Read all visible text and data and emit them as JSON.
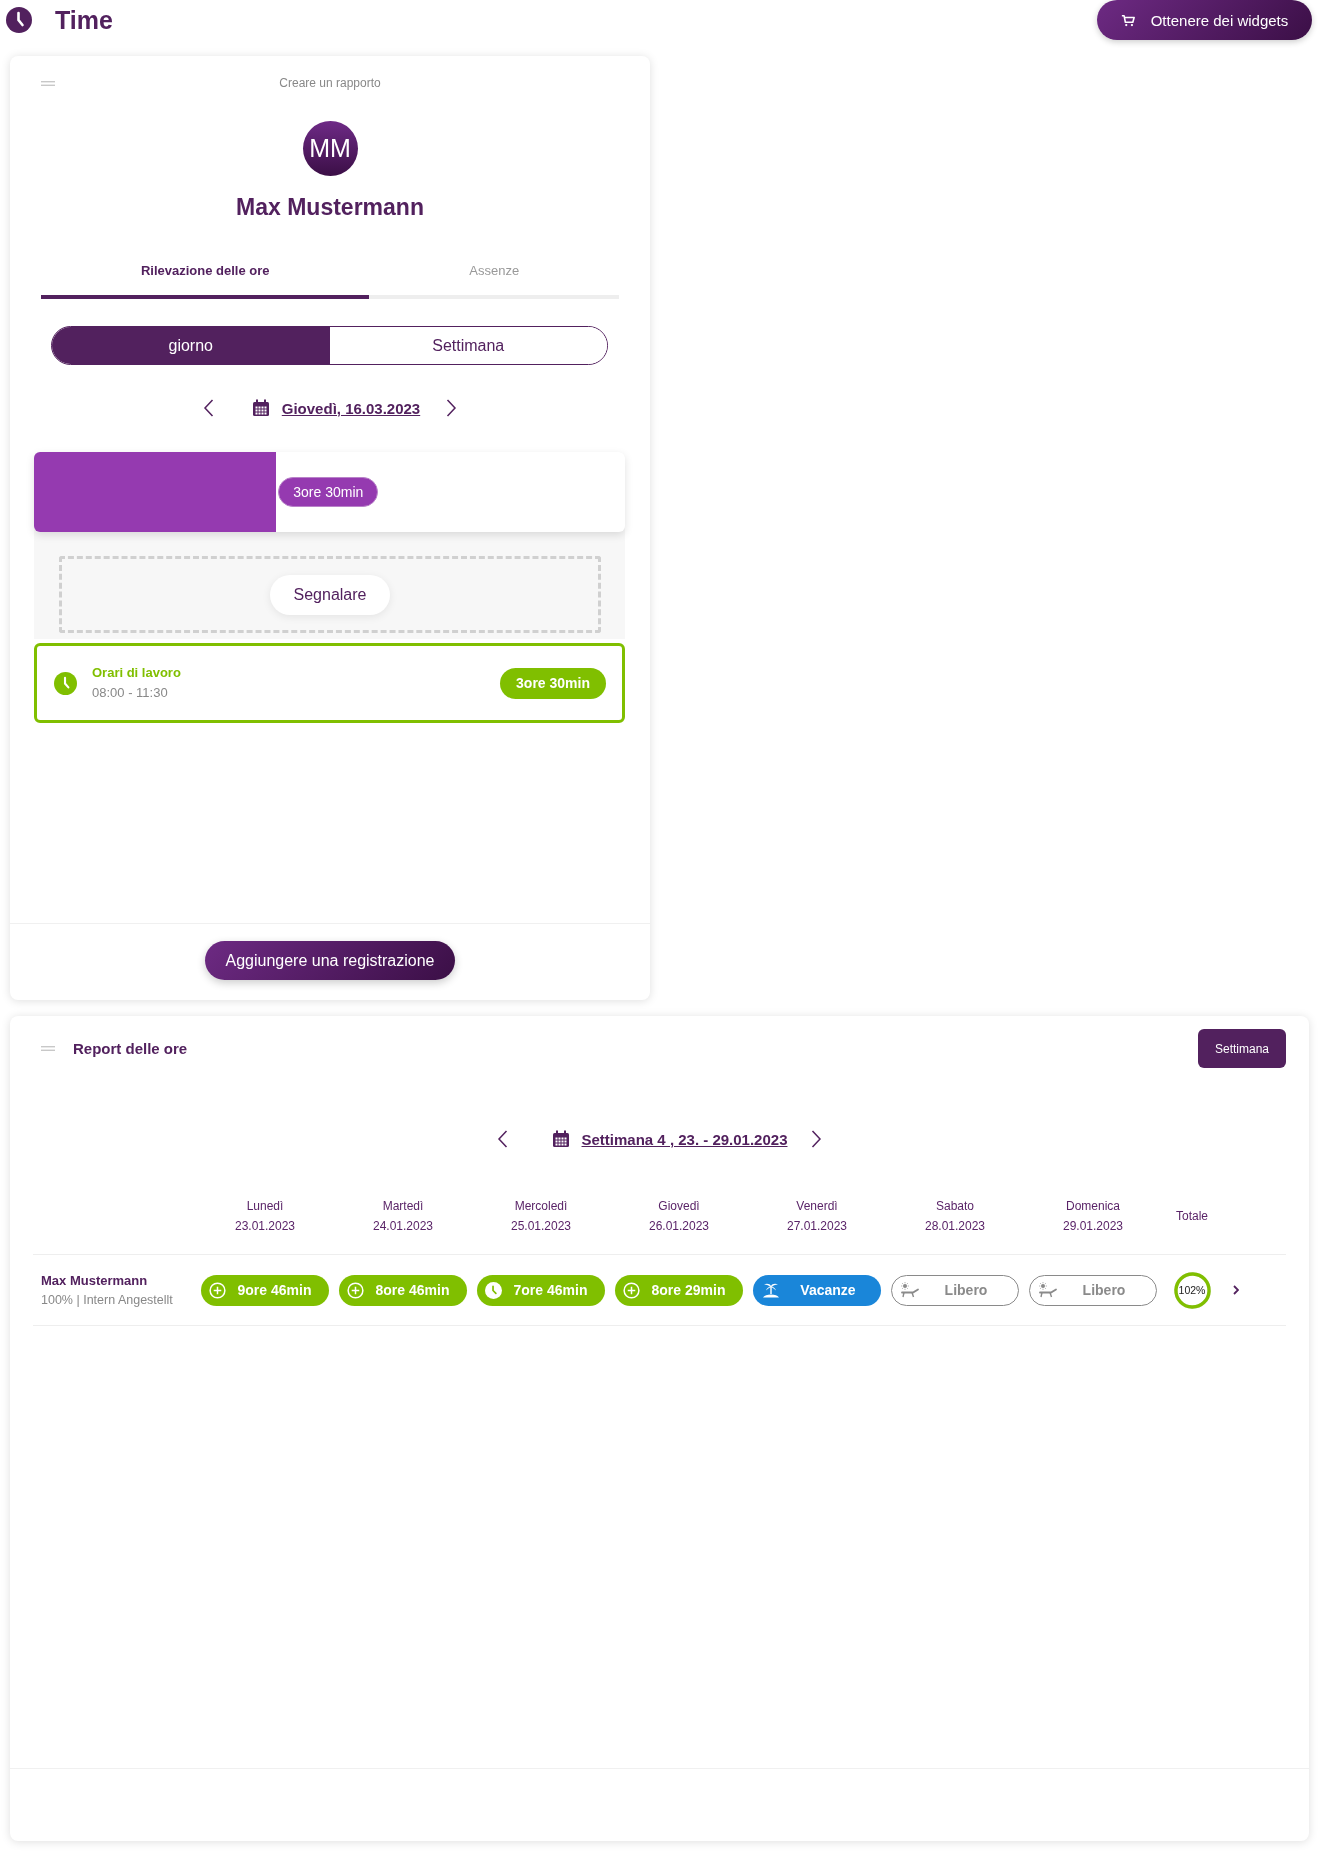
{
  "header": {
    "title": "Time",
    "widgets_button": "Ottenere dei widgets"
  },
  "day_card": {
    "title": "Creare un rapporto",
    "avatar": "MM",
    "name": "Max Mustermann",
    "tabs": [
      {
        "label": "Rilevazione delle ore",
        "selected": true
      },
      {
        "label": "Assenze",
        "selected": false
      }
    ],
    "view_toggle": [
      {
        "label": "giorno",
        "selected": true
      },
      {
        "label": "Settimana",
        "selected": false
      }
    ],
    "date": "Giovedì, 16.03.2023",
    "timeline": {
      "level": 0.41,
      "duration": "3ore 30min"
    },
    "report_button": "Segnalare",
    "entries": [
      {
        "kind": "work",
        "title": "Orari di lavoro",
        "time": "08:00 - 11:30",
        "duration": "3ore 30min"
      }
    ],
    "add_button": "Aggiungere una registrazione"
  },
  "report_card": {
    "title": "Report delle ore",
    "period_button": "Settimana",
    "week": "Settimana 4 , 23. - 29.01.2023",
    "columns": [
      {
        "day": "Lunedì",
        "date": "23.01.2023"
      },
      {
        "day": "Martedì",
        "date": "24.01.2023"
      },
      {
        "day": "Mercoledì",
        "date": "25.01.2023"
      },
      {
        "day": "Giovedì",
        "date": "26.01.2023"
      },
      {
        "day": "Venerdì",
        "date": "27.01.2023"
      },
      {
        "day": "Sabato",
        "date": "28.01.2023"
      },
      {
        "day": "Domenica",
        "date": "29.01.2023"
      }
    ],
    "total_column": "Totale",
    "rows": [
      {
        "name": "Max Mustermann",
        "details": "100% | Intern Angestellt",
        "days": [
          {
            "kind": "overtime",
            "label": "9ore 46min"
          },
          {
            "kind": "overtime",
            "label": "8ore 46min"
          },
          {
            "kind": "undertime",
            "label": "7ore 46min"
          },
          {
            "kind": "overtime",
            "label": "8ore 29min"
          },
          {
            "kind": "vacation",
            "label": "Vacanze"
          },
          {
            "kind": "free",
            "label": "Libero"
          },
          {
            "kind": "free",
            "label": "Libero"
          }
        ],
        "total": {
          "label": "102%",
          "level": 1
        }
      }
    ]
  }
}
